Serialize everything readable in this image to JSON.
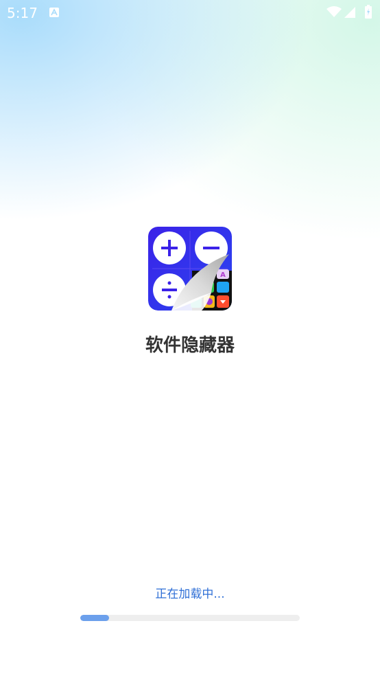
{
  "status_bar": {
    "time": "5:17",
    "icons": [
      "a-notification-icon",
      "wifi-icon",
      "signal-icon",
      "battery-icon"
    ]
  },
  "app": {
    "name": "软件隐藏器",
    "icon": "calculator-app-hider-icon"
  },
  "loading": {
    "text": "正在加载中...",
    "progress_fraction": 0.13
  },
  "colors": {
    "accent": "#2f6fd6",
    "progress_fill": "#6ca0ec",
    "progress_track": "#eeeeee",
    "title": "#333333"
  }
}
